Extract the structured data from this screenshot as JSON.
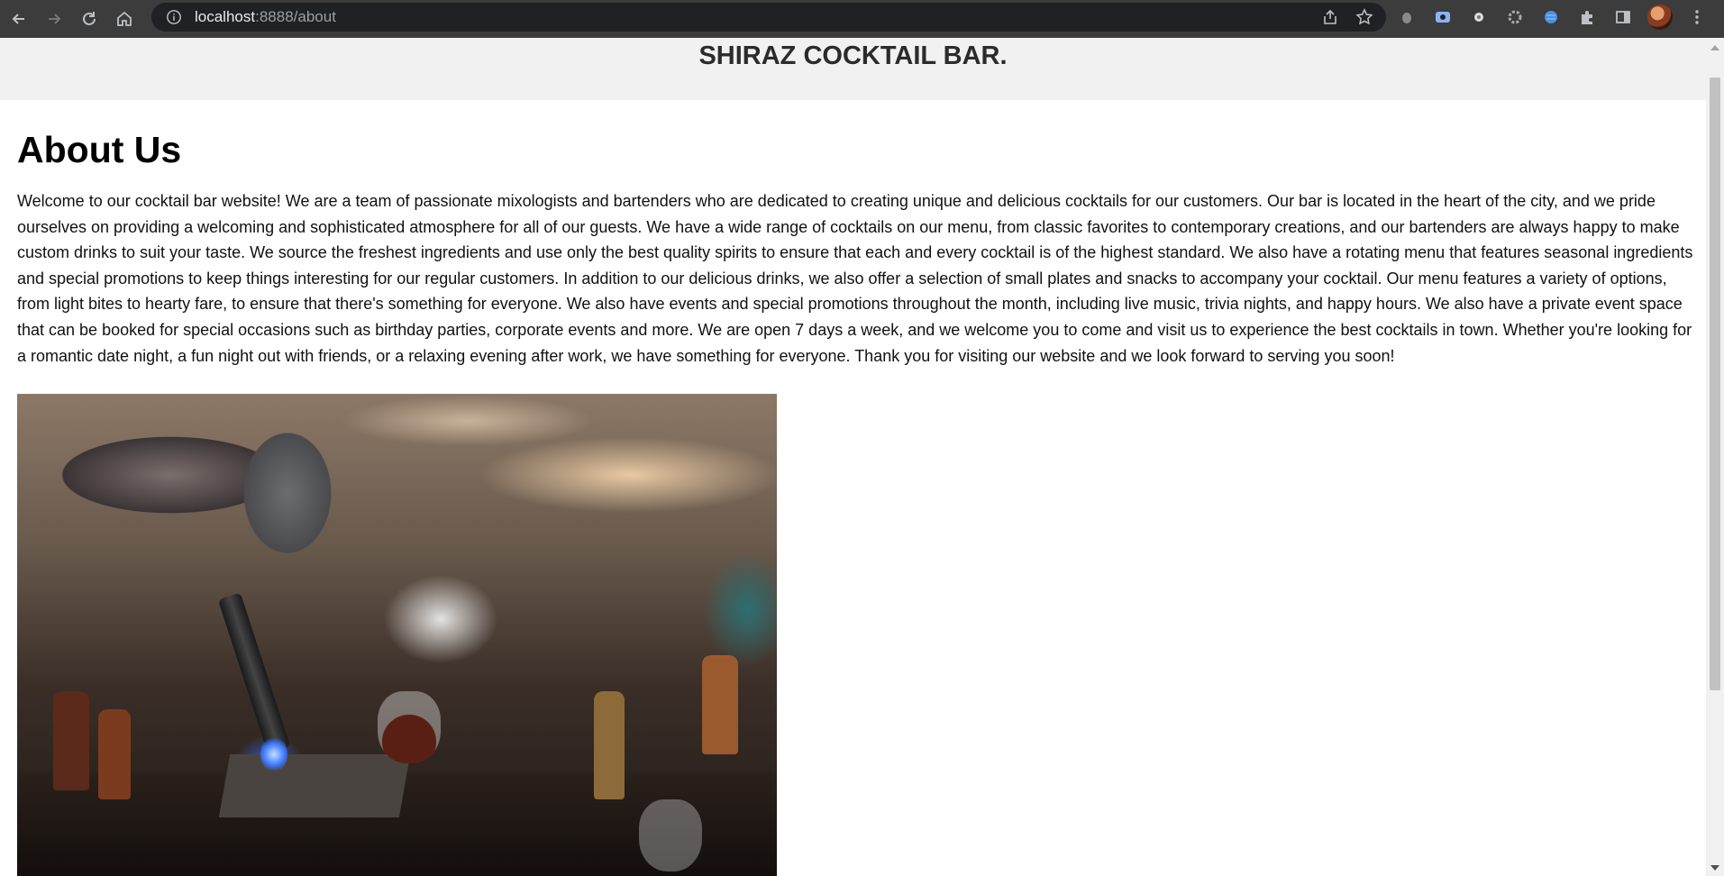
{
  "browser": {
    "url_host": "localhost",
    "url_path": ":8888/about",
    "icons": {
      "back": "arrow-left-icon",
      "forward": "arrow-right-icon",
      "reload": "reload-icon",
      "home": "home-icon",
      "info": "info-icon",
      "share": "share-icon",
      "bookmark": "star-icon",
      "extensions": [
        "bug-icon",
        "screen-capture-icon",
        "circle-icon",
        "gear-icon",
        "globe-icon",
        "puzzle-icon",
        "side-panel-icon",
        "avatar-icon",
        "more-vert-icon"
      ]
    }
  },
  "site": {
    "title": "SHIRAZ COCKTAIL BAR."
  },
  "main": {
    "heading": "About Us",
    "paragraph": "Welcome to our cocktail bar website! We are a team of passionate mixologists and bartenders who are dedicated to creating unique and delicious cocktails for our customers. Our bar is located in the heart of the city, and we pride ourselves on providing a welcoming and sophisticated atmosphere for all of our guests. We have a wide range of cocktails on our menu, from classic favorites to contemporary creations, and our bartenders are always happy to make custom drinks to suit your taste. We source the freshest ingredients and use only the best quality spirits to ensure that each and every cocktail is of the highest standard. We also have a rotating menu that features seasonal ingredients and special promotions to keep things interesting for our regular customers. In addition to our delicious drinks, we also offer a selection of small plates and snacks to accompany your cocktail. Our menu features a variety of options, from light bites to hearty fare, to ensure that there's something for everyone. We also have events and special promotions throughout the month, including live music, trivia nights, and happy hours. We also have a private event space that can be booked for special occasions such as birthday parties, corporate events and more. We are open 7 days a week, and we welcome you to come and visit us to experience the best cocktails in town. Whether you're looking for a romantic date night, a fun night out with friends, or a relaxing evening after work, we have something for everyone. Thank you for visiting our website and we look forward to serving you soon!"
  },
  "colors": {
    "chrome_bg": "#3c3c3c",
    "omnibox_bg": "#202124",
    "header_bg": "#f1f1f1",
    "title_text": "#2b2b2b"
  }
}
